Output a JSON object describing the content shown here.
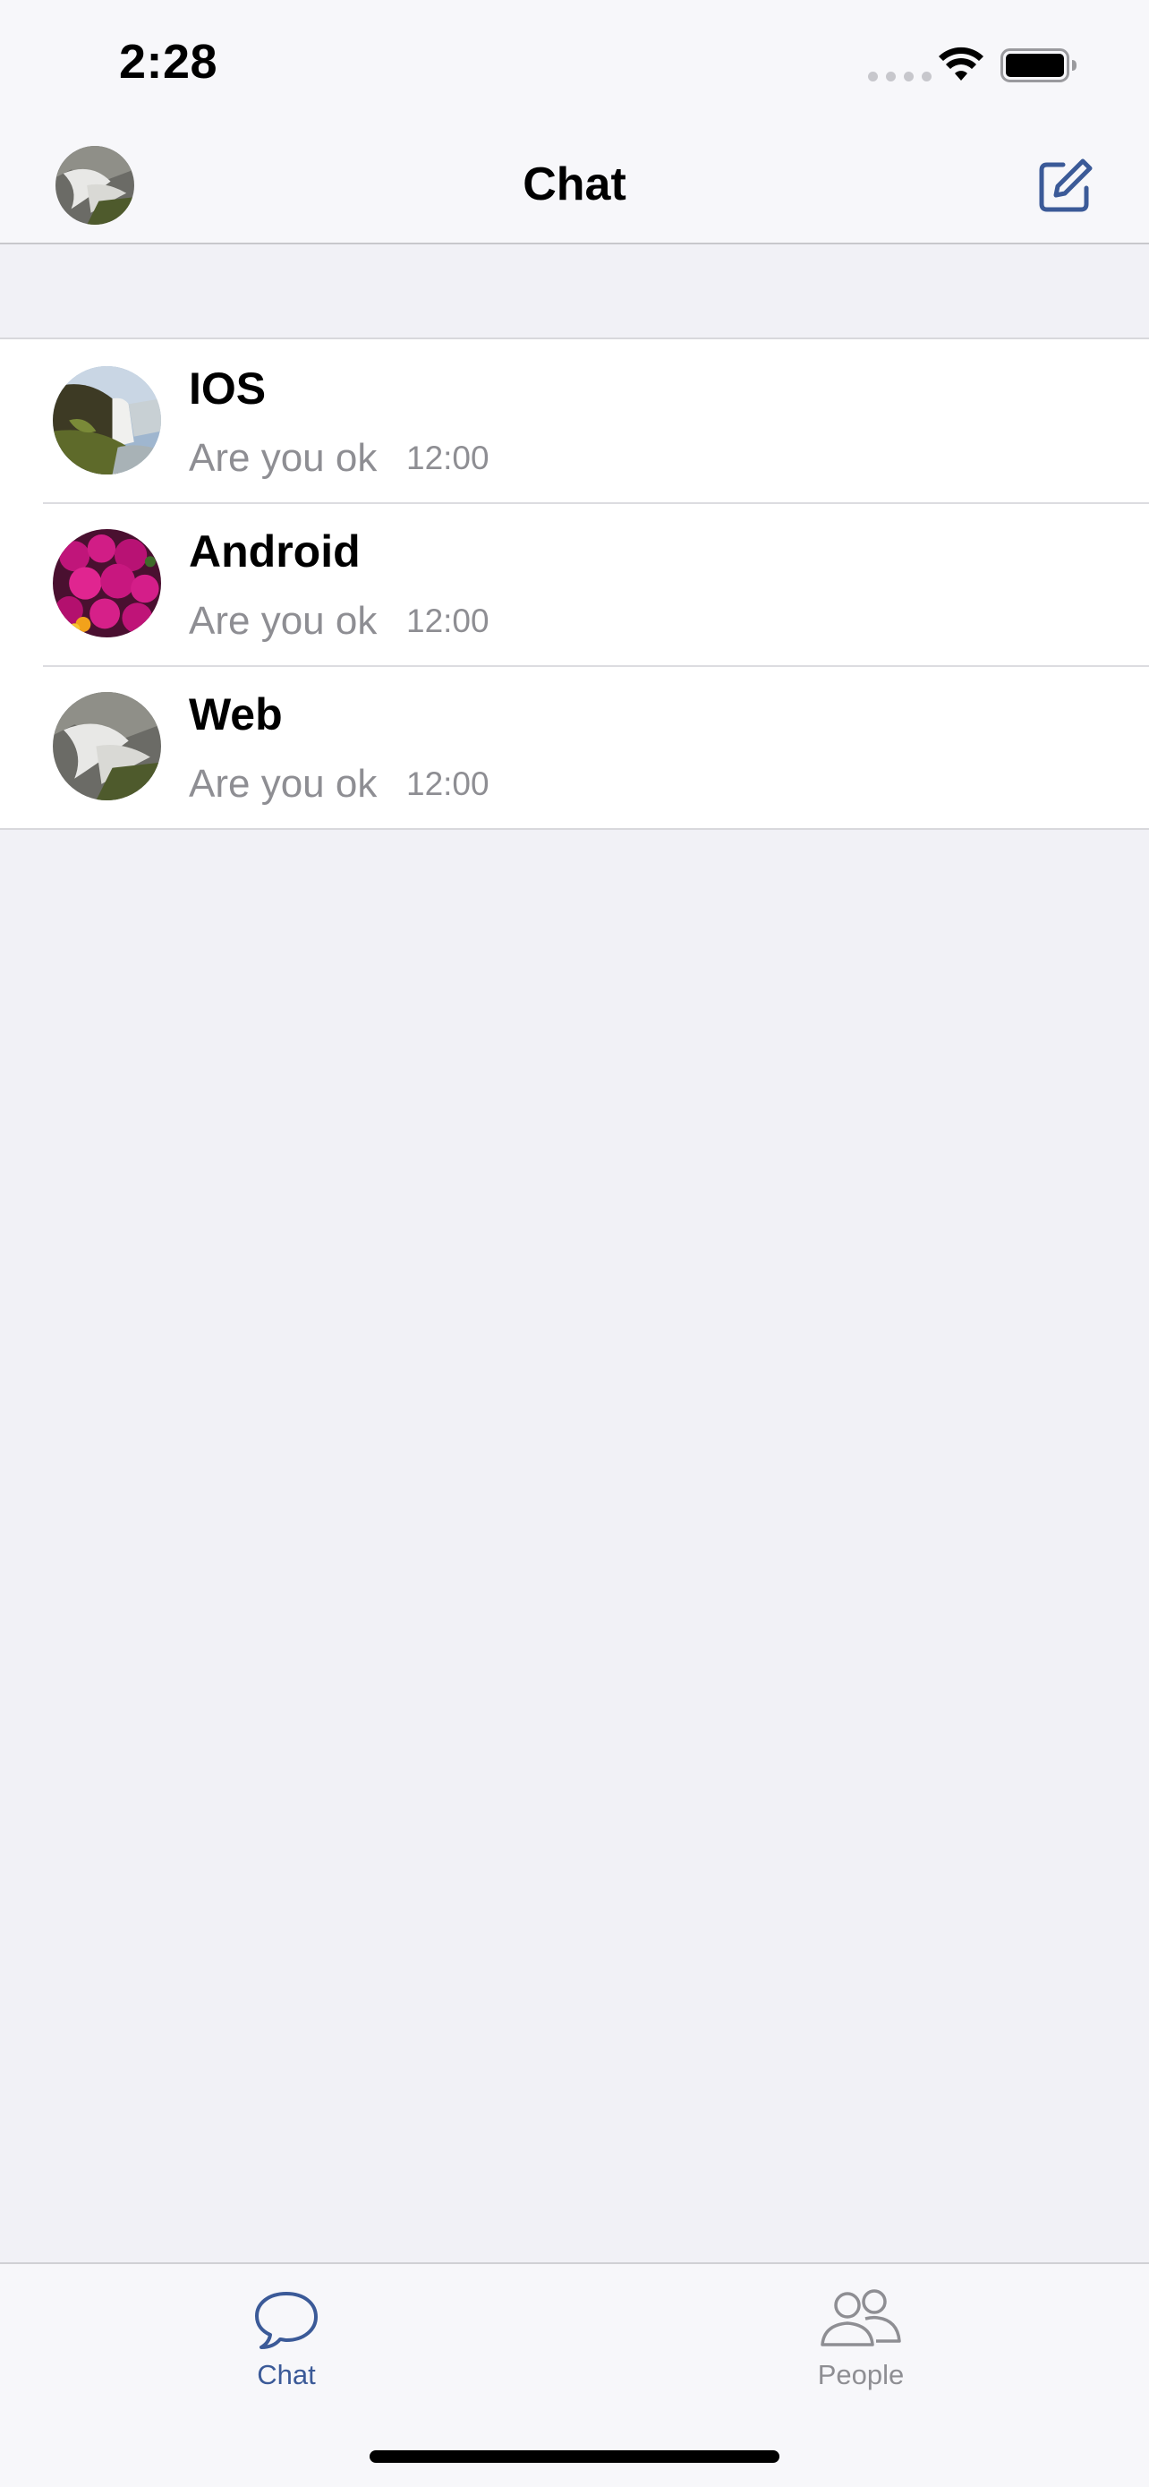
{
  "status_bar": {
    "time": "2:28",
    "icons": [
      "cellular-signal-icon",
      "wifi-icon",
      "battery-icon"
    ]
  },
  "nav": {
    "title": "Chat",
    "left_icon": "profile-avatar",
    "right_icon": "compose-icon"
  },
  "chats": [
    {
      "name": "IOS",
      "message": "Are you ok",
      "time": "12:00",
      "avatar": "waterfall-coast-avatar"
    },
    {
      "name": "Android",
      "message": "Are you ok",
      "time": "12:00",
      "avatar": "flowers-avatar"
    },
    {
      "name": "Web",
      "message": "Are you ok",
      "time": "12:00",
      "avatar": "waterfall-rocks-avatar"
    }
  ],
  "tabs": [
    {
      "label": "Chat",
      "icon": "speech-bubble-icon",
      "selected": true
    },
    {
      "label": "People",
      "icon": "people-icon",
      "selected": false
    }
  ],
  "colors": {
    "accent": "#3b5a98",
    "tab_inactive": "#8e8e93",
    "secondary_text": "#8e8e93",
    "background": "#f1f1f6",
    "bar_background": "#f7f7fa"
  }
}
